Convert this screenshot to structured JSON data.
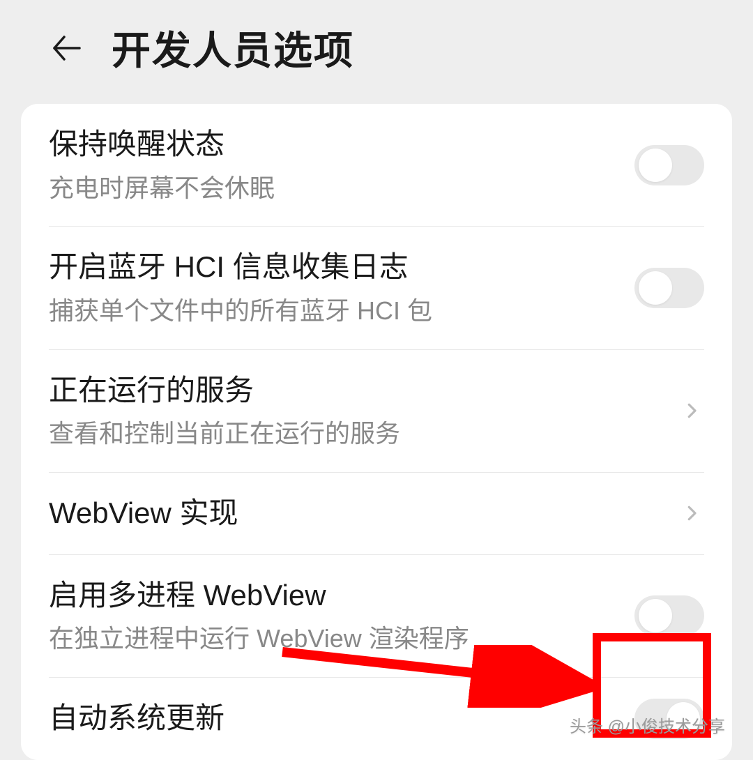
{
  "header": {
    "title": "开发人员选项"
  },
  "rows": [
    {
      "title": "保持唤醒状态",
      "sub": "充电时屏幕不会休眠",
      "control": "toggle",
      "state": "off"
    },
    {
      "title": "开启蓝牙 HCI 信息收集日志",
      "sub": "捕获单个文件中的所有蓝牙 HCI 包",
      "control": "toggle",
      "state": "off"
    },
    {
      "title": "正在运行的服务",
      "sub": "查看和控制当前正在运行的服务",
      "control": "chevron"
    },
    {
      "title": "WebView 实现",
      "sub": "",
      "control": "chevron"
    },
    {
      "title": "启用多进程 WebView",
      "sub": "在独立进程中运行 WebView 渲染程序",
      "control": "toggle",
      "state": "off"
    },
    {
      "title": "自动系统更新",
      "sub": "",
      "control": "toggle",
      "state": "off-right"
    }
  ],
  "watermark": "头条 @小俊技术分享",
  "annotation": {
    "highlight_row_index": 5,
    "arrow_color": "#ff0000"
  }
}
